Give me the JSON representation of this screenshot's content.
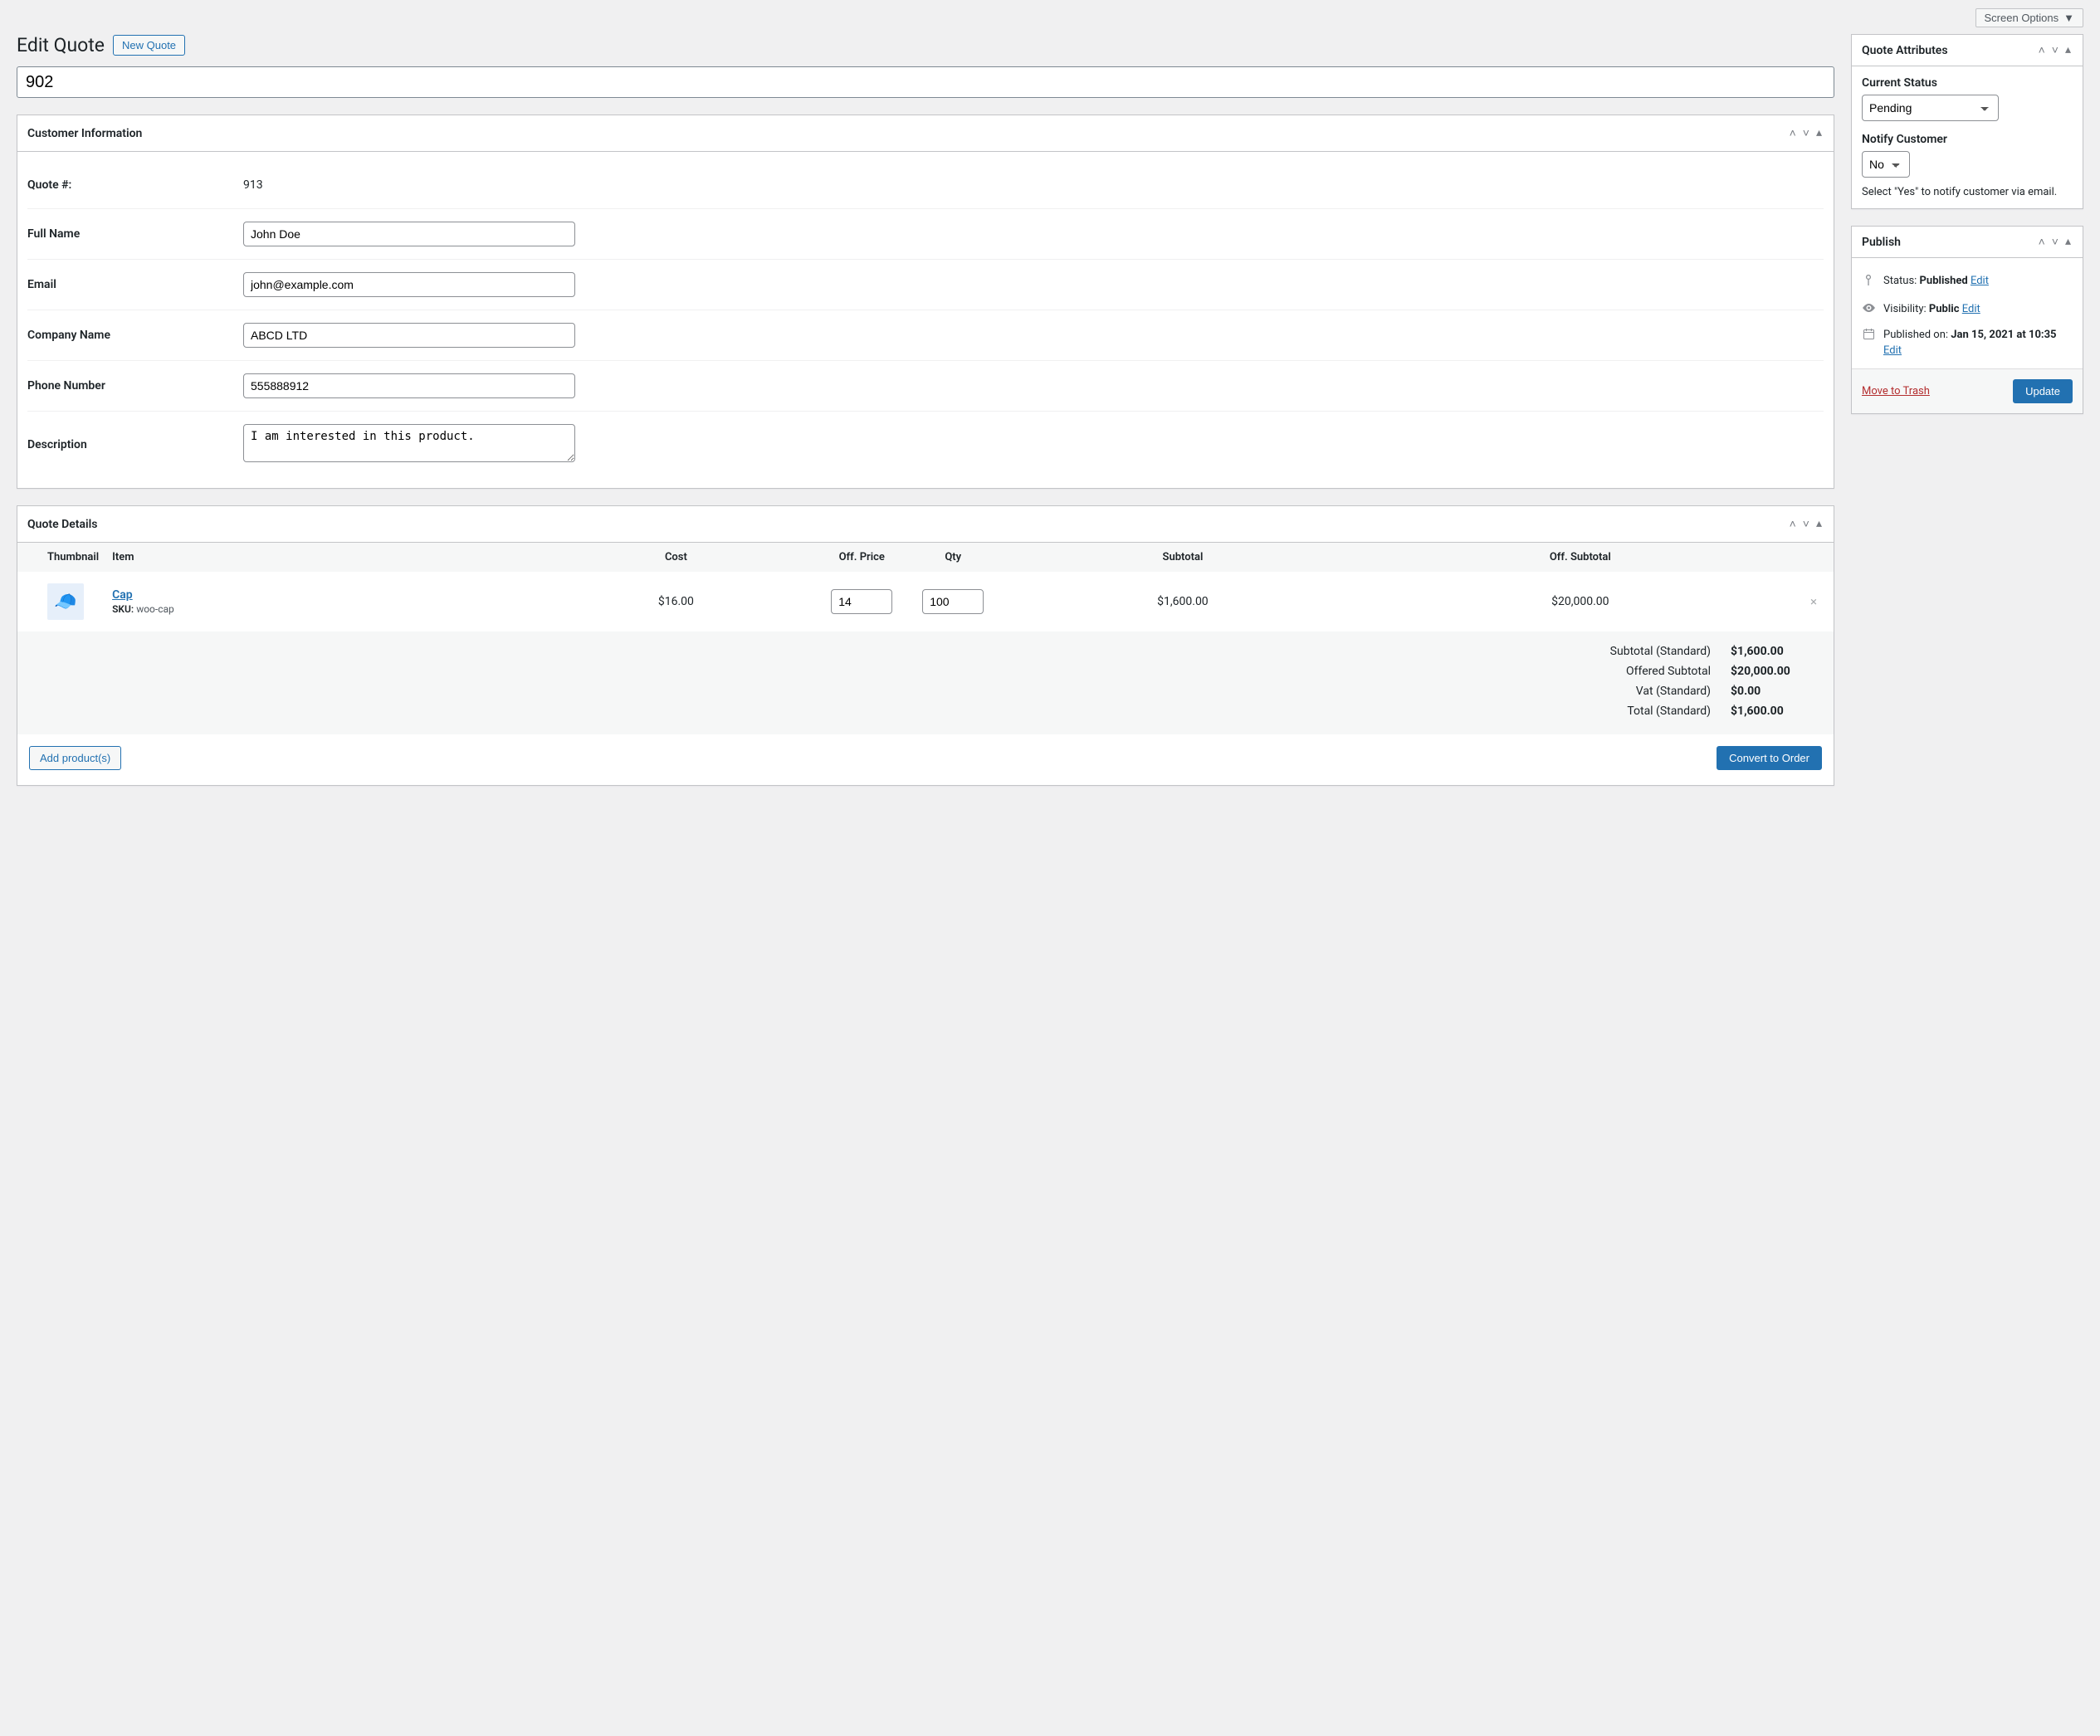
{
  "screen_options_label": "Screen Options",
  "page_title": "Edit Quote",
  "new_quote_label": "New Quote",
  "title_value": "902",
  "customer_info": {
    "heading": "Customer Information",
    "fields": {
      "quote_num_label": "Quote #:",
      "quote_num_value": "913",
      "full_name_label": "Full Name",
      "full_name_value": "John Doe",
      "email_label": "Email",
      "email_value": "john@example.com",
      "company_label": "Company Name",
      "company_value": "ABCD LTD",
      "phone_label": "Phone Number",
      "phone_value": "555888912",
      "description_label": "Description",
      "description_value": "I am interested in this product."
    }
  },
  "quote_details": {
    "heading": "Quote Details",
    "columns": {
      "thumbnail": "Thumbnail",
      "item": "Item",
      "cost": "Cost",
      "off_price": "Off. Price",
      "qty": "Qty",
      "subtotal": "Subtotal",
      "off_subtotal": "Off. Subtotal"
    },
    "items": [
      {
        "name": "Cap",
        "sku_label": "SKU:",
        "sku": "woo-cap",
        "cost": "$16.00",
        "off_price": "14",
        "qty": "100",
        "subtotal": "$1,600.00",
        "off_subtotal": "$20,000.00"
      }
    ],
    "totals": {
      "subtotal_std_label": "Subtotal (Standard)",
      "subtotal_std_value": "$1,600.00",
      "offered_subtotal_label": "Offered Subtotal",
      "offered_subtotal_value": "$20,000.00",
      "vat_std_label": "Vat (Standard)",
      "vat_std_value": "$0.00",
      "total_std_label": "Total (Standard)",
      "total_std_value": "$1,600.00"
    },
    "add_products_label": "Add product(s)",
    "convert_order_label": "Convert to Order"
  },
  "attributes": {
    "heading": "Quote Attributes",
    "status_label": "Current Status",
    "status_value": "Pending",
    "notify_label": "Notify Customer",
    "notify_value": "No",
    "help_text": "Select \"Yes\" to notify customer via email."
  },
  "publish": {
    "heading": "Publish",
    "status_prefix": "Status: ",
    "status_value": "Published",
    "visibility_prefix": "Visibility: ",
    "visibility_value": "Public",
    "published_prefix": "Published on: ",
    "published_value": "Jan 15, 2021 at 10:35",
    "edit_label": "Edit",
    "trash_label": "Move to Trash",
    "update_label": "Update"
  }
}
